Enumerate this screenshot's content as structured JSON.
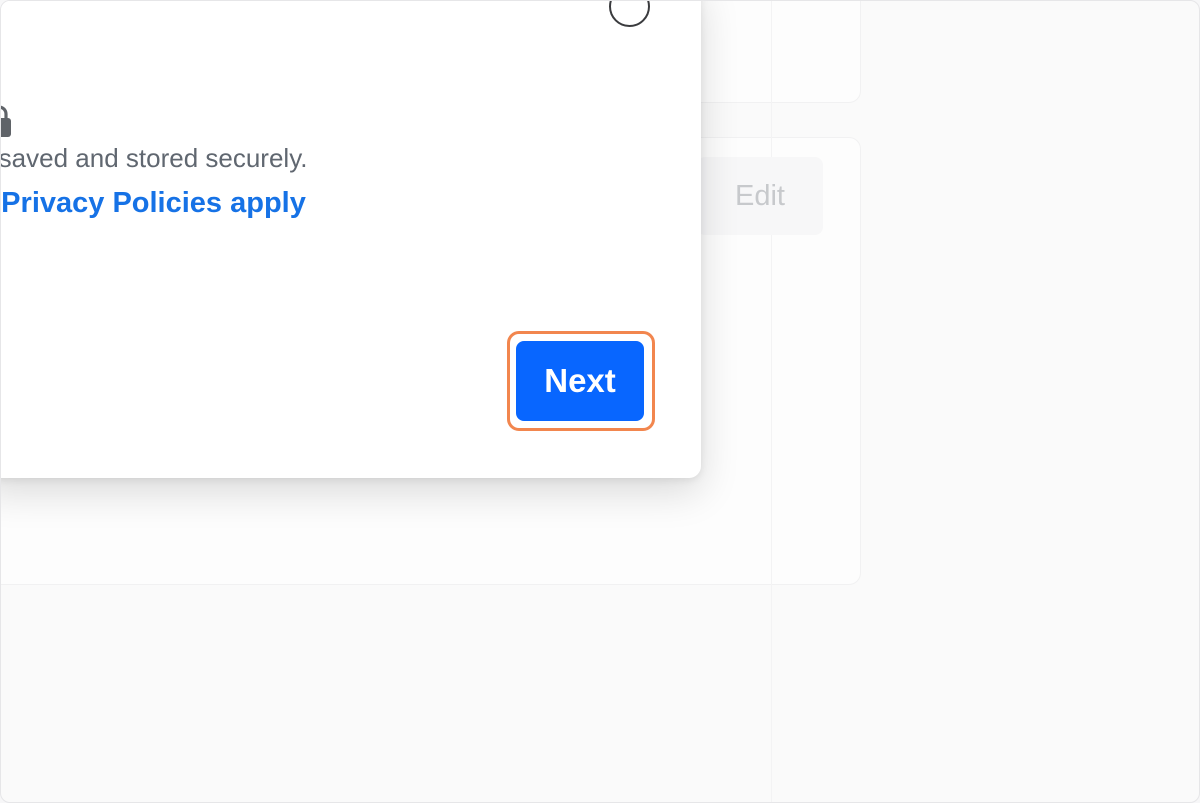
{
  "modal": {
    "secure_text": "e saved and stored securely.",
    "privacy_link": "e Privacy Policies apply",
    "next_label": "Next",
    "close_icon": "circle-outline-icon",
    "lock_icon": "lock-icon"
  },
  "background": {
    "edit_label": "Edit"
  },
  "colors": {
    "accent": "#0866ff",
    "link": "#1672e6",
    "highlight": "#f2864e",
    "muted_text": "#606770"
  }
}
